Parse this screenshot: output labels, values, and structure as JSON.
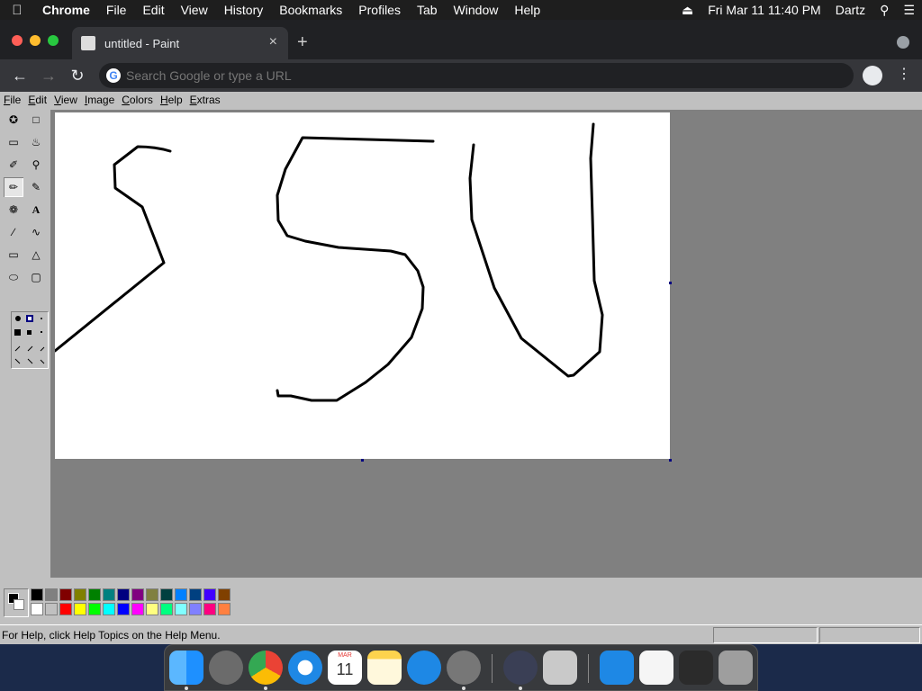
{
  "menubar": {
    "app": "Chrome",
    "items": [
      "File",
      "Edit",
      "View",
      "History",
      "Bookmarks",
      "Profiles",
      "Tab",
      "Window",
      "Help"
    ],
    "datetime": "Fri Mar 11  11:40 PM",
    "user": "Dartz"
  },
  "browser": {
    "tab_title": "untitled - Paint",
    "omnibox_placeholder": "Search Google or type a URL",
    "new_tab_label": "+",
    "close_tab_label": "×"
  },
  "paint": {
    "menu": [
      "File",
      "Edit",
      "View",
      "Image",
      "Colors",
      "Help",
      "Extras"
    ],
    "status_text": "For Help, click Help Topics on the Help Menu.",
    "palette_top": [
      "#000000",
      "#808080",
      "#800000",
      "#808000",
      "#008000",
      "#008080",
      "#000080",
      "#800080",
      "#808040",
      "#004040",
      "#0080ff",
      "#004080",
      "#4000ff",
      "#804000"
    ],
    "palette_bottom": [
      "#ffffff",
      "#c0c0c0",
      "#ff0000",
      "#ffff00",
      "#00ff00",
      "#00ffff",
      "#0000ff",
      "#ff00ff",
      "#ffff80",
      "#00ff80",
      "#80ffff",
      "#8080ff",
      "#ff0080",
      "#ff8040"
    ]
  },
  "dock": {
    "calendar_month": "MAR",
    "calendar_day": "11"
  }
}
